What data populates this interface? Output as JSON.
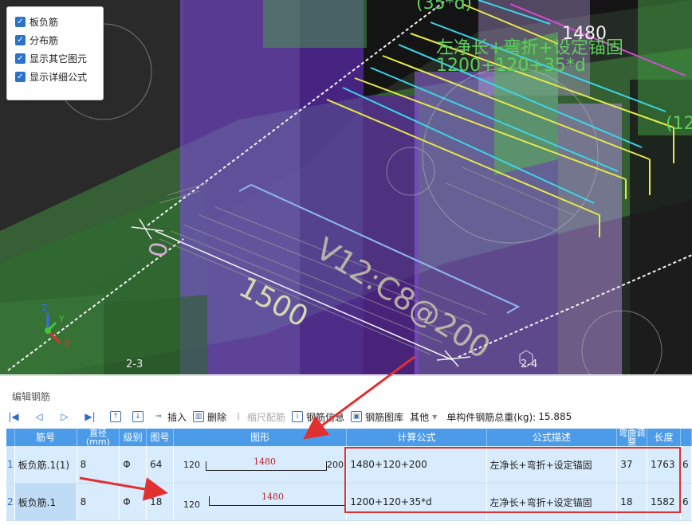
{
  "viewport": {
    "label_left": "2-3",
    "label_right": "2-4",
    "annotations": {
      "formula_top_partial": "(35*d)",
      "length_1480": "1480",
      "formula_desc": "左净长+弯折+设定锚固",
      "formula_calc": "1200+120+35*d",
      "rebar_label": "V12:C8@200",
      "left_zero": "0",
      "length_1500": "1500",
      "right_partial": "(12"
    },
    "axes": {
      "z": "Z",
      "y": "Y",
      "x": "X"
    }
  },
  "check_panel": {
    "items": [
      {
        "label": "板负筋",
        "checked": true
      },
      {
        "label": "分布筋",
        "checked": true
      },
      {
        "label": "显示其它图元",
        "checked": true
      },
      {
        "label": "显示详细公式",
        "checked": true
      }
    ]
  },
  "editor": {
    "title": "编辑钢筋",
    "toolbar": {
      "insert": "插入",
      "delete": "删除",
      "scale_rebar": "缩尺配筋",
      "rebar_info": "钢筋信息",
      "rebar_library": "钢筋图库",
      "other": "其他",
      "total_weight_label": "单构件钢筋总重(kg):",
      "total_weight_value": "15.885"
    },
    "columns": [
      "筋号",
      "直径(mm)",
      "级别",
      "图号",
      "图形",
      "计算公式",
      "公式描述",
      "弯曲调整",
      "长度"
    ],
    "column_display": {
      "col1": "筋号",
      "col2": "直径\n(mm)",
      "col3": "级别",
      "col4": "图号",
      "col5": "图形",
      "col6": "计算公式",
      "col7": "公式描述",
      "col8": "弯曲调\n整",
      "col9": "长度"
    },
    "rows": [
      {
        "idx": "1",
        "name": "板负筋.1(1)",
        "diameter": "8",
        "grade": "Φ",
        "figure_no": "64",
        "shape_left": "120",
        "shape_mid": "1480",
        "shape_right": "200",
        "formula": "1480+120+200",
        "description": "左净长+弯折+设定锚固",
        "bend_adjust": "37",
        "length": "1763",
        "extra": "6"
      },
      {
        "idx": "2",
        "name": "板负筋.1",
        "diameter": "8",
        "grade": "Φ",
        "figure_no": "18",
        "shape_left": "120",
        "shape_mid": "1480",
        "shape_right": "",
        "formula": "1200+120+35*d",
        "description": "左净长+弯折+设定锚固",
        "bend_adjust": "18",
        "length": "1582",
        "extra": "6"
      }
    ]
  },
  "colors": {
    "header_blue": "#4c9be8",
    "row_bg": "#d9ecfd",
    "highlight_red": "#e03030",
    "viewport_bg": "#141414"
  }
}
